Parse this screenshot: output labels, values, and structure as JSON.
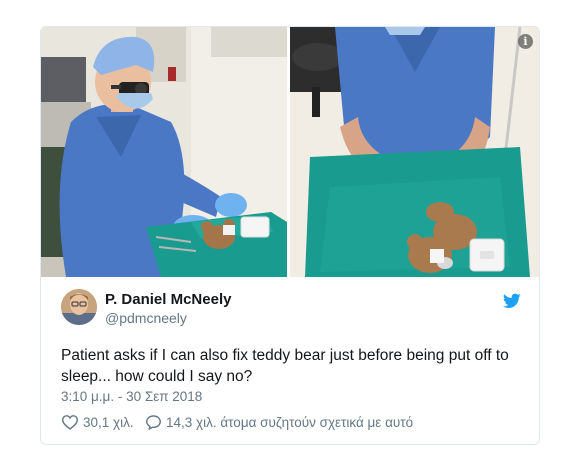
{
  "media": {
    "left_icon": "surgeon-photo",
    "right_icon": "teddy-bear-photo",
    "info_icon": "info-icon",
    "info_label": "i"
  },
  "author": {
    "name": "P. Daniel McNeely",
    "handle": "@pdmcneely",
    "avatar_icon": "avatar",
    "brand_icon": "twitter-bird-icon",
    "brand_color": "#1da1f2"
  },
  "tweet": {
    "text": "Patient asks if I can also fix teddy bear just before being put off to sleep... how could I say no?",
    "timestamp": "3:10 μ.μ. - 30 Σεπ 2018"
  },
  "actions": {
    "likes_icon": "heart-icon",
    "likes": "30,1 χιλ.",
    "replies_icon": "speech-bubble-icon",
    "replies": "14,3 χιλ. άτομα συζητούν σχετικά με αυτό"
  },
  "colors": {
    "text": "#14171a",
    "secondary": "#657786",
    "border": "#e1e8ed",
    "drape": "#1a9b8f",
    "scrubs": "#4a78c4"
  }
}
